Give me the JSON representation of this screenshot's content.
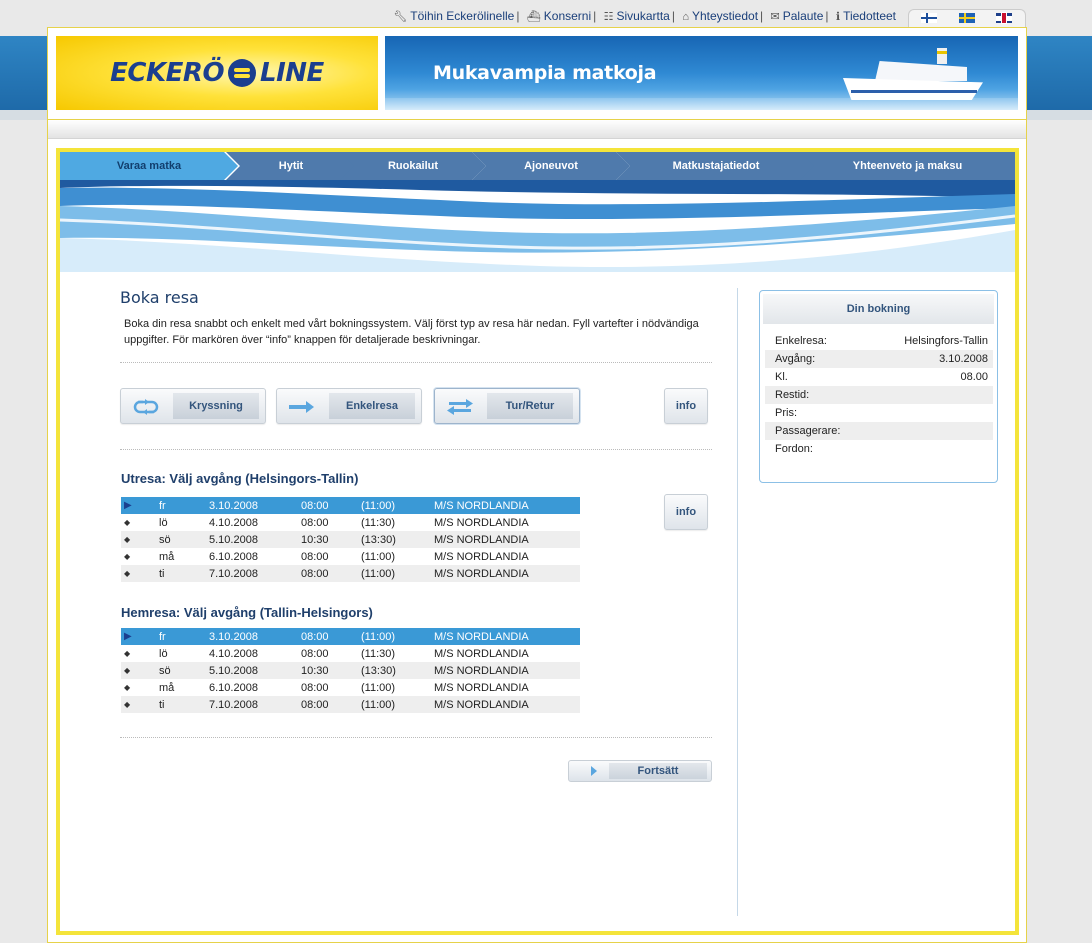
{
  "topnav": {
    "links": [
      {
        "label": "Töihin Eckerölinelle",
        "icon": "wrench-icon"
      },
      {
        "label": "Konserni",
        "icon": "ship-icon"
      },
      {
        "label": "Sivukartta",
        "icon": "sitemap-icon"
      },
      {
        "label": "Yhteystiedot",
        "icon": "lock-icon"
      },
      {
        "label": "Palaute",
        "icon": "mail-icon"
      },
      {
        "label": "Tiedotteet",
        "icon": "info-icon"
      }
    ],
    "separator": "|",
    "languages": [
      "fi-flag-icon",
      "se-flag-icon",
      "uk-flag-icon"
    ]
  },
  "header": {
    "logo_left": "ECKERÖ",
    "logo_right": "LINE",
    "banner_text": "Mukavampia matkoja",
    "brand_color": "#1b3f8f",
    "accent_color": "#ffe23a"
  },
  "steps": [
    "Varaa matka",
    "Hytit",
    "Ruokailut",
    "Ajoneuvot",
    "Matkustajatiedot",
    "Yhteenveto ja maksu"
  ],
  "steps_active": 0,
  "content": {
    "title": "Boka resa",
    "intro": "Boka din resa snabbt och enkelt med vårt bokningssystem. Välj först typ av resa här nedan. Fyll vartefter i nödvändiga uppgifter. För markören över “info” knappen för detaljerade beskrivningar."
  },
  "trip_types": {
    "options": [
      {
        "label": "Kryssning",
        "icon": "round-trip-icon"
      },
      {
        "label": "Enkelresa",
        "icon": "one-way-arrow-icon"
      },
      {
        "label": "Tur/Retur",
        "icon": "return-arrows-icon"
      }
    ],
    "selected": 2,
    "info_label": "info"
  },
  "outbound": {
    "title": "Utresa: Välj avgång (Helsingors-Tallin)",
    "selected": 0,
    "rows": [
      {
        "day": "fr",
        "date": "3.10.2008",
        "dep": "08:00",
        "dur": "(11:00)",
        "ship": "M/S NORDLANDIA"
      },
      {
        "day": "lö",
        "date": "4.10.2008",
        "dep": "08:00",
        "dur": "(11:30)",
        "ship": "M/S NORDLANDIA"
      },
      {
        "day": "sö",
        "date": "5.10.2008",
        "dep": "10:30",
        "dur": "(13:30)",
        "ship": "M/S NORDLANDIA"
      },
      {
        "day": "må",
        "date": "6.10.2008",
        "dep": "08:00",
        "dur": "(11:00)",
        "ship": "M/S NORDLANDIA"
      },
      {
        "day": "ti",
        "date": "7.10.2008",
        "dep": "08:00",
        "dur": "(11:00)",
        "ship": "M/S NORDLANDIA"
      }
    ]
  },
  "inbound": {
    "title": "Hemresa: Välj avgång (Tallin-Helsingors)",
    "selected": 0,
    "rows": [
      {
        "day": "fr",
        "date": "3.10.2008",
        "dep": "08:00",
        "dur": "(11:00)",
        "ship": "M/S NORDLANDIA"
      },
      {
        "day": "lö",
        "date": "4.10.2008",
        "dep": "08:00",
        "dur": "(11:30)",
        "ship": "M/S NORDLANDIA"
      },
      {
        "day": "sö",
        "date": "5.10.2008",
        "dep": "10:30",
        "dur": "(13:30)",
        "ship": "M/S NORDLANDIA"
      },
      {
        "day": "må",
        "date": "6.10.2008",
        "dep": "08:00",
        "dur": "(11:00)",
        "ship": "M/S NORDLANDIA"
      },
      {
        "day": "ti",
        "date": "7.10.2008",
        "dep": "08:00",
        "dur": "(11:00)",
        "ship": "M/S NORDLANDIA"
      }
    ]
  },
  "summary": {
    "title": "Din bokning",
    "rows": [
      {
        "label": "Enkelresa:",
        "value": "Helsingfors-Tallin"
      },
      {
        "label": "Avgång:",
        "value": "3.10.2008"
      },
      {
        "label": "Kl.",
        "value": "08.00"
      },
      {
        "label": "Restid:",
        "value": ""
      },
      {
        "label": "Pris:",
        "value": ""
      },
      {
        "label": "Passagerare:",
        "value": ""
      },
      {
        "label": "Fordon:",
        "value": ""
      }
    ]
  },
  "continue_label": "Fortsätt",
  "colors": {
    "frame_yellow": "#f4e43a",
    "step_blue": "#4f7aac",
    "step_active": "#4fa9e2",
    "row_selected": "#3a99d6"
  }
}
